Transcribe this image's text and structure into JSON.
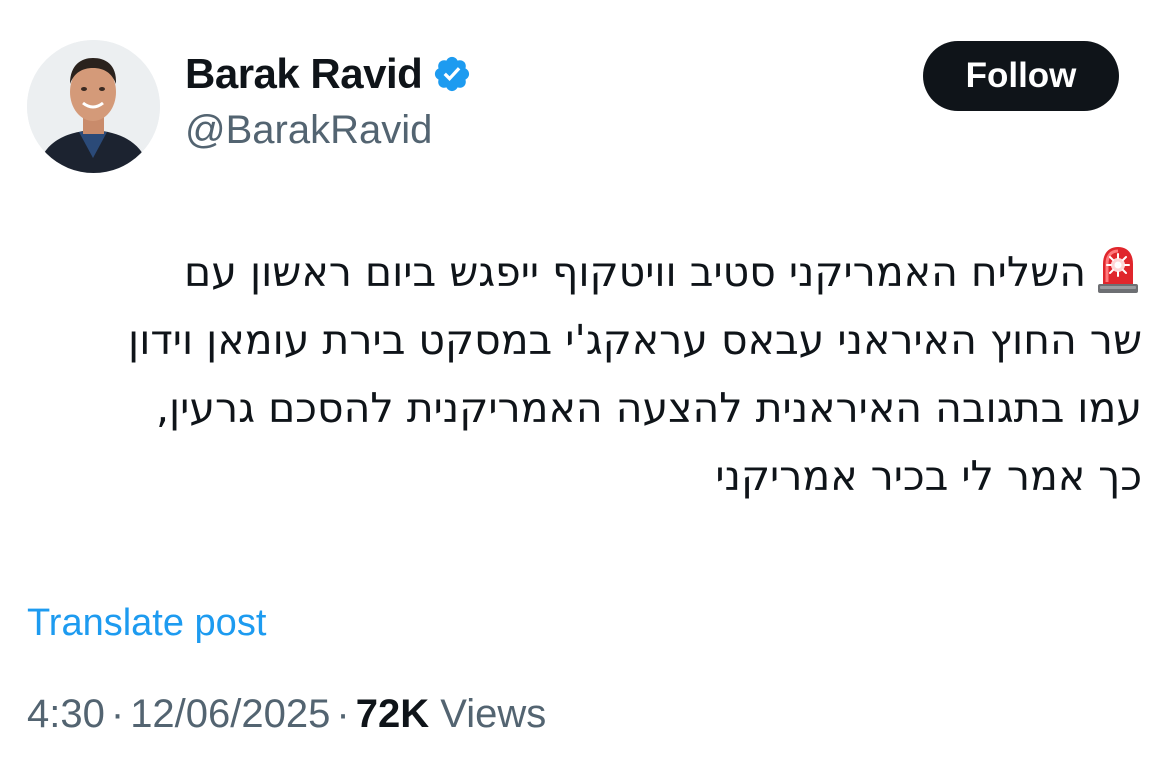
{
  "author": {
    "display_name": "Barak Ravid",
    "handle": "@BarakRavid",
    "verified": true
  },
  "follow_button": {
    "label": "Follow"
  },
  "tweet": {
    "lines": [
      "השליח האמריקני סטיב וויטקוף ייפגש ביום ראשון עם",
      "שר החוץ האיראני עבאס עראקג'י במסקט בירת עומאן וידון",
      "עמו בתגובה האיראנית להצעה האמריקנית להסכם גרעין,",
      "כך אמר לי בכיר אמריקני"
    ],
    "leading_emoji": "police-car-light-icon"
  },
  "translate_link": "Translate post",
  "meta": {
    "time": "4:30",
    "date": "12/06/2025",
    "separator": "·",
    "views_count": "72K",
    "views_label": "Views"
  },
  "colors": {
    "accent": "#1d9bf0",
    "text": "#0f1419",
    "secondary": "#536471",
    "button_bg": "#0f1419"
  }
}
